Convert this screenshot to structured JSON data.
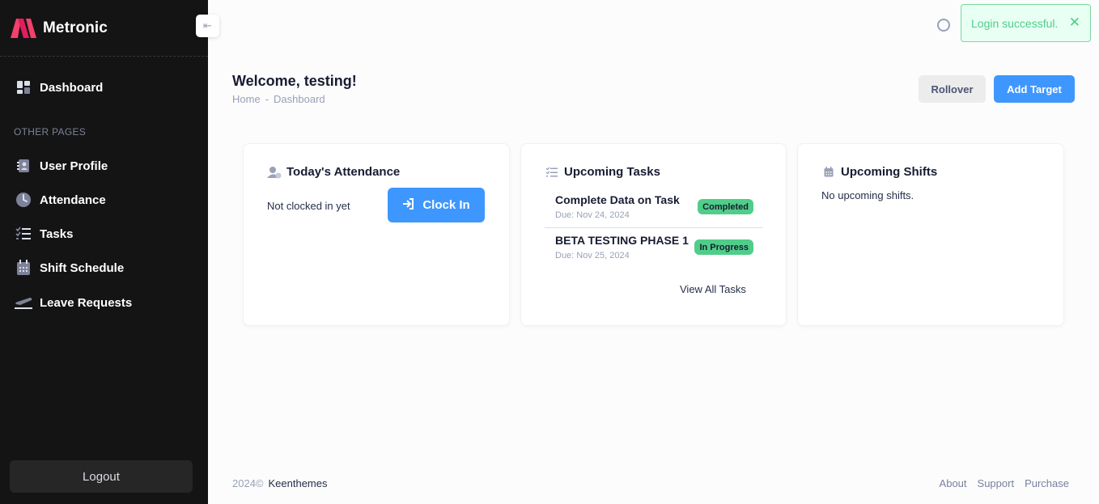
{
  "brand": {
    "name": "Metronic"
  },
  "sidebar": {
    "section_label": "OTHER PAGES",
    "items": [
      {
        "label": "Dashboard",
        "icon": "dashboard-icon"
      },
      {
        "label": "User Profile",
        "icon": "user-profile-icon"
      },
      {
        "label": "Attendance",
        "icon": "clock-icon"
      },
      {
        "label": "Tasks",
        "icon": "task-list-icon"
      },
      {
        "label": "Shift Schedule",
        "icon": "calendar-icon"
      },
      {
        "label": "Leave Requests",
        "icon": "plane-icon"
      }
    ],
    "logout_label": "Logout"
  },
  "toast": {
    "message": "Login successful."
  },
  "header": {
    "title": "Welcome, testing!",
    "breadcrumb": {
      "home": "Home",
      "separator": "-",
      "current": "Dashboard"
    },
    "rollover_label": "Rollover",
    "add_target_label": "Add Target"
  },
  "attendance": {
    "title": "Today's Attendance",
    "status": "Not clocked in yet",
    "clock_in_label": "Clock In"
  },
  "tasks": {
    "title": "Upcoming Tasks",
    "items": [
      {
        "name": "Complete Data on Task",
        "due": "Due: Nov 24, 2024",
        "status": "Completed"
      },
      {
        "name": "BETA TESTING PHASE 1",
        "due": "Due: Nov 25, 2024",
        "status": "In Progress"
      }
    ],
    "view_all_label": "View All Tasks"
  },
  "shifts": {
    "title": "Upcoming Shifts",
    "empty_text": "No upcoming shifts."
  },
  "footer": {
    "year": "2024©",
    "company": "Keenthemes",
    "links": [
      "About",
      "Support",
      "Purchase"
    ]
  },
  "colors": {
    "sidebar_bg": "#141414",
    "primary": "#3e97ff",
    "success": "#50cd89",
    "brand_logo": "#f1416c"
  }
}
